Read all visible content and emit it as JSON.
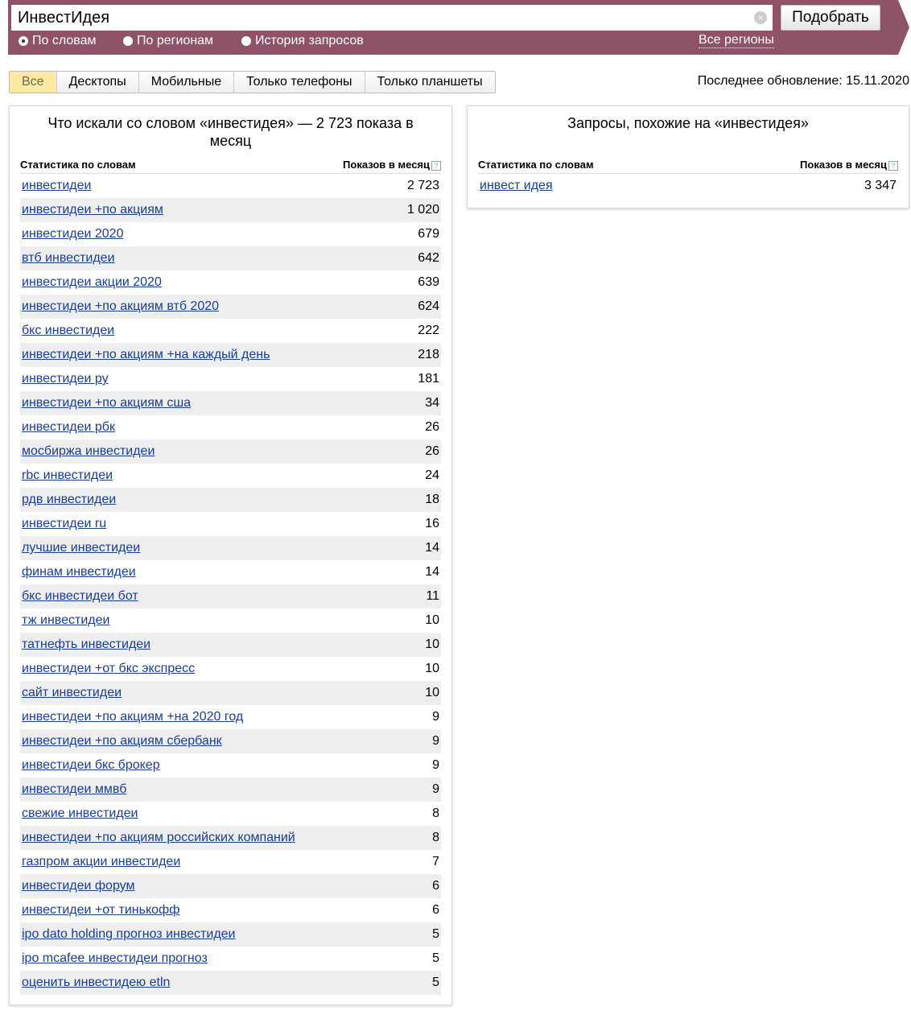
{
  "search": {
    "value": "ИнвестИдея",
    "submit": "Подобрать"
  },
  "modes": [
    "По словам",
    "По регионам",
    "История запросов"
  ],
  "regions_link": "Все регионы",
  "tabs": [
    "Все",
    "Десктопы",
    "Мобильные",
    "Только телефоны",
    "Только планшеты"
  ],
  "last_update": "Последнее обновление: 15.11.2020",
  "left": {
    "title": "Что искали со словом «инвестидея» — 2 723 показа в месяц",
    "col1": "Статистика по словам",
    "col2": "Показов в месяц",
    "rows": [
      [
        "инвестидеи",
        "2 723"
      ],
      [
        "инвестидеи +по акциям",
        "1 020"
      ],
      [
        "инвестидеи 2020",
        "679"
      ],
      [
        "втб инвестидеи",
        "642"
      ],
      [
        "инвестидеи акции 2020",
        "639"
      ],
      [
        "инвестидеи +по акциям втб 2020",
        "624"
      ],
      [
        "бкс инвестидеи",
        "222"
      ],
      [
        "инвестидеи +по акциям +на каждый день",
        "218"
      ],
      [
        "инвестидеи ру",
        "181"
      ],
      [
        "инвестидеи +по акциям сша",
        "34"
      ],
      [
        "инвестидеи рбк",
        "26"
      ],
      [
        "мосбиржа инвестидеи",
        "26"
      ],
      [
        "rbc инвестидеи",
        "24"
      ],
      [
        "рдв инвестидеи",
        "18"
      ],
      [
        "инвестидеи ru",
        "16"
      ],
      [
        "лучшие инвестидеи",
        "14"
      ],
      [
        "финам инвестидеи",
        "14"
      ],
      [
        "бкс инвестидеи бот",
        "11"
      ],
      [
        "тж инвестидеи",
        "10"
      ],
      [
        "татнефть инвестидеи",
        "10"
      ],
      [
        "инвестидеи +от бкс экспресс",
        "10"
      ],
      [
        "сайт инвестидеи",
        "10"
      ],
      [
        "инвестидеи +по акциям +на 2020 год",
        "9"
      ],
      [
        "инвестидеи +по акциям сбербанк",
        "9"
      ],
      [
        "инвестидеи бкс брокер",
        "9"
      ],
      [
        "инвестидеи ммвб",
        "9"
      ],
      [
        "свежие инвестидеи",
        "8"
      ],
      [
        "инвестидеи +по акциям российских компаний",
        "8"
      ],
      [
        "газпром акции инвестидеи",
        "7"
      ],
      [
        "инвестидеи форум",
        "6"
      ],
      [
        "инвестидеи +от тинькофф",
        "6"
      ],
      [
        "ipo dato holding прогноз инвестидеи",
        "5"
      ],
      [
        "ipo mcafee инвестидеи прогноз",
        "5"
      ],
      [
        "оценить инвестидею etln",
        "5"
      ]
    ]
  },
  "right": {
    "title": "Запросы, похожие на «инвестидея»",
    "col1": "Статистика по словам",
    "col2": "Показов в месяц",
    "rows": [
      [
        "инвест идея",
        "3 347"
      ]
    ]
  }
}
